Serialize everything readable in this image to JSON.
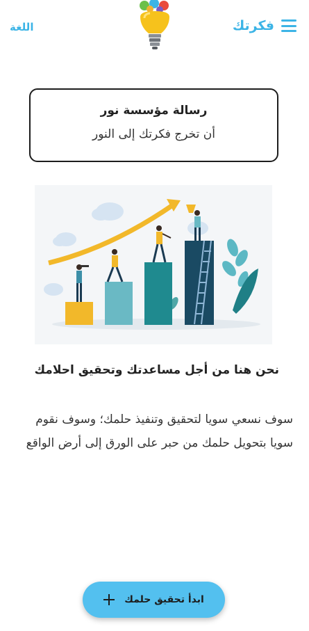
{
  "header": {
    "brand_name": "فكرتك",
    "language_label": "اللغة"
  },
  "mission": {
    "title": "رسالة مؤسسة نور",
    "subtitle": "أن تخرج فكرتك إلى النور"
  },
  "main": {
    "headline": "نحن هنا من أجل مساعدتك وتحقيق احلامك",
    "body": "سوف نسعي سويا لتحقيق وتنفيذ حلمك؛ وسوف نقوم سويا بتحويل حلمك من حبر على الورق إلى أرض الواقع"
  },
  "fab": {
    "label": "ابدأ تحقيق حلمك"
  },
  "colors": {
    "accent": "#3cb4e6",
    "fab": "#53c0ef"
  },
  "icons": [
    "menu-icon",
    "lightbulb-logo",
    "plus-icon"
  ]
}
